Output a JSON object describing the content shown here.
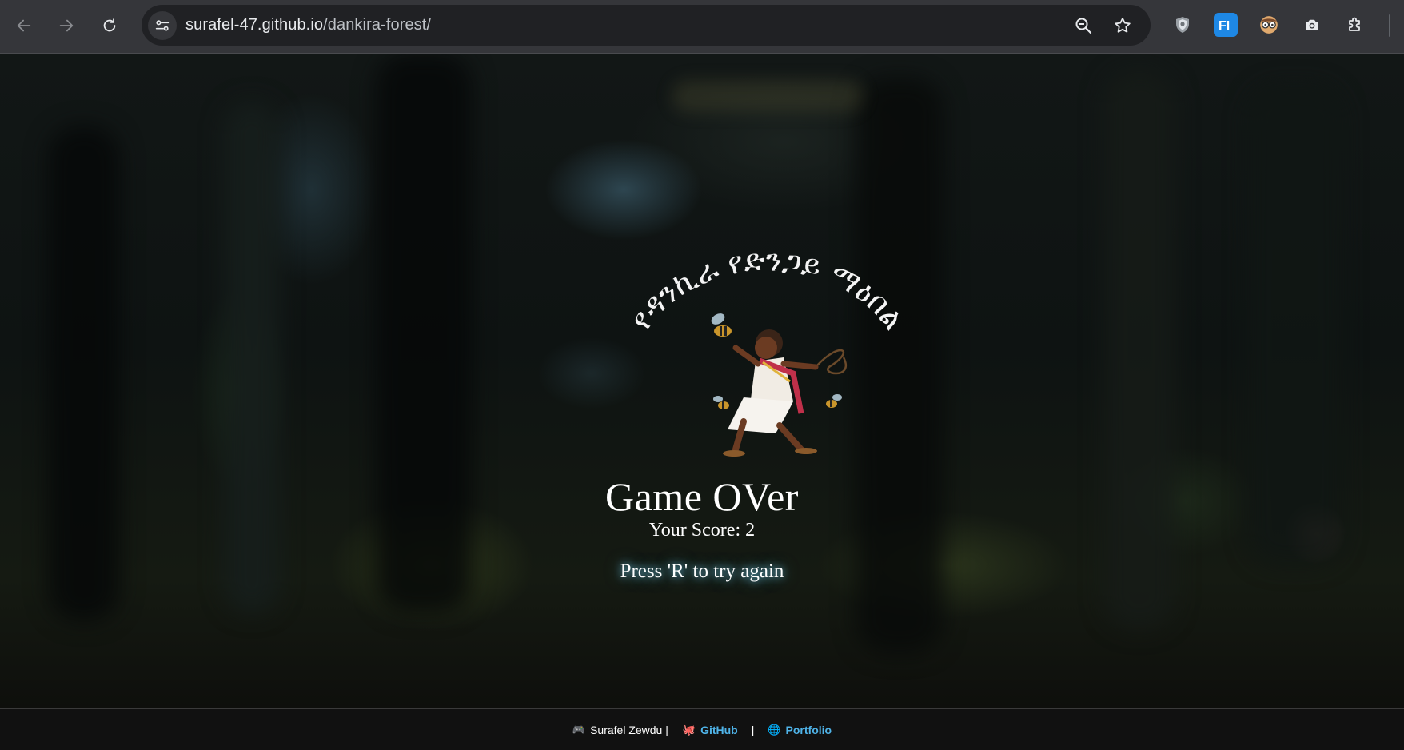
{
  "browser": {
    "url_domain": "surafel-47.github.io",
    "url_path": "/dankira-forest/"
  },
  "game": {
    "logo_text": "የዳንኪራ የድንጋይ ማዕበል",
    "title": "Game OVer",
    "score_text": "Your Score: 2",
    "retry_text": "Press 'R' to try again"
  },
  "footer": {
    "author_emoji": "🎮",
    "author_text": "Surafel Zewdu |",
    "github_emoji": "🐙",
    "github_label": "GitHub",
    "separator": "|",
    "portfolio_emoji": "🌐",
    "portfolio_label": "Portfolio"
  },
  "colors": {
    "chrome_bg": "#35363a",
    "omnibox_bg": "#202124",
    "link": "#4fb3e8",
    "retry_glow": "#78dcff"
  }
}
